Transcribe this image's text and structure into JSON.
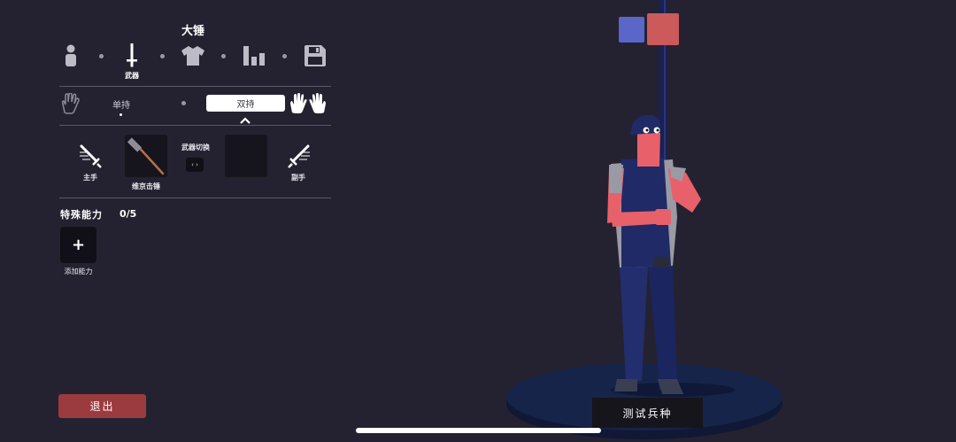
{
  "editor": {
    "title": "大锤",
    "steps": [
      {
        "icon": "person-icon",
        "label": ""
      },
      {
        "icon": "sword-icon",
        "label": "武器"
      },
      {
        "icon": "shirt-icon",
        "label": ""
      },
      {
        "icon": "stats-icon",
        "label": ""
      },
      {
        "icon": "save-icon",
        "label": ""
      }
    ],
    "grip": {
      "one_hand": "单持",
      "two_hand": "双持",
      "selected": "two_hand"
    },
    "weapons": {
      "main_hand_label": "主手",
      "main_weapon_name": "维京击锤",
      "swap_label": "武器切换",
      "swap_glyph": "‹ ›",
      "off_hand_label": "副手"
    },
    "abilities": {
      "title": "特殊能力",
      "count": "0/5",
      "add_glyph": "+",
      "add_label": "添加能力"
    },
    "exit_label": "退出"
  },
  "scene": {
    "test_unit_label": "测试兵种",
    "team_colors": [
      "#5a67c8",
      "#cc5a5a"
    ]
  },
  "colors": {
    "background": "#242230",
    "exit_button": "#9c3b3f",
    "skin": "#e8606a",
    "overalls": "#1f2a66"
  }
}
